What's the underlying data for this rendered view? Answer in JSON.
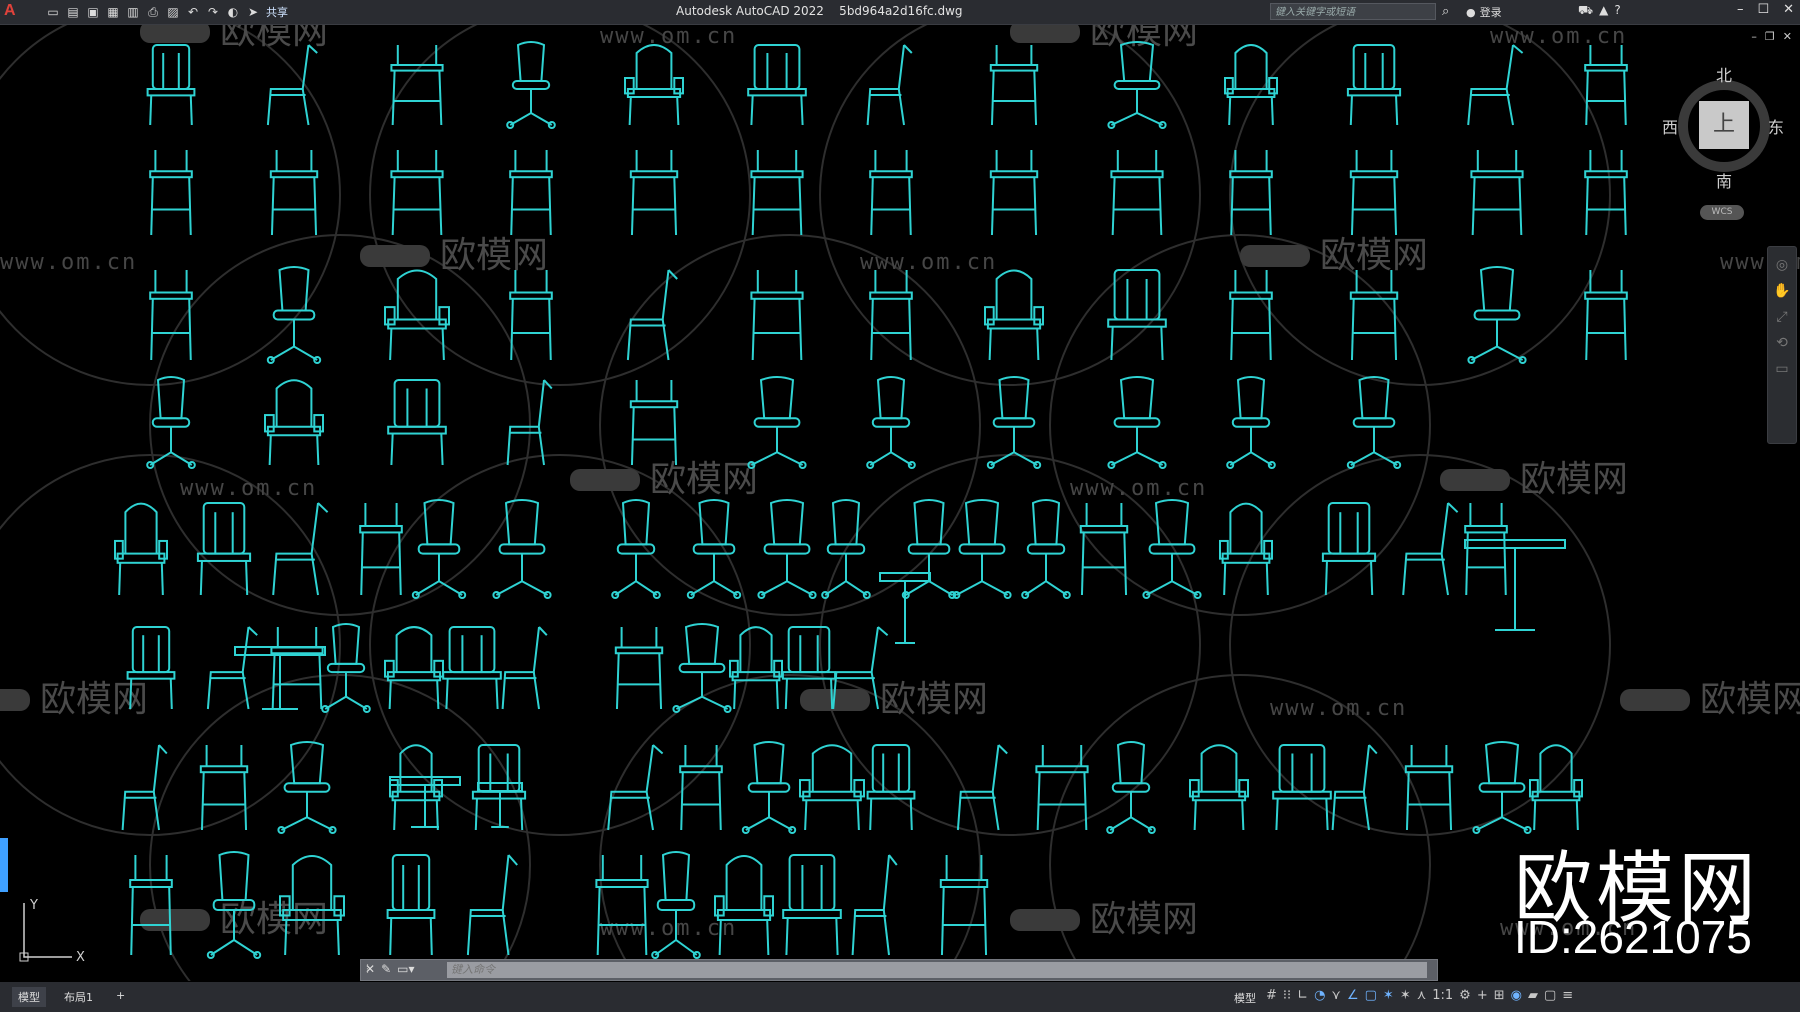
{
  "titlebar": {
    "app_logo": "A",
    "share_label": "共享",
    "title": "Autodesk AutoCAD 2022    5bd964a2d16fc.dwg",
    "search_placeholder": "键入关键字或短语",
    "login_label": "登录"
  },
  "viewcube": {
    "north": "北",
    "south": "南",
    "east": "东",
    "west": "西",
    "face": "上",
    "wcs": "WCS"
  },
  "watermark": {
    "url": "www.om.cn",
    "brand": "欧模网",
    "big_brand": "欧模网",
    "big_id": "ID:2621075"
  },
  "ucs": {
    "x_label": "X",
    "y_label": "Y"
  },
  "command": {
    "placeholder": "键入命令"
  },
  "status": {
    "tabs": [
      {
        "label": "模型"
      },
      {
        "label": "布局1"
      },
      {
        "label": "+"
      }
    ],
    "model_label": "模型",
    "scale_label": "1:1"
  },
  "colors": {
    "drawing_line": "#2fd3d3",
    "background": "#000000",
    "title_bar": "#2a2c31",
    "accent": "#3fa0ff"
  }
}
